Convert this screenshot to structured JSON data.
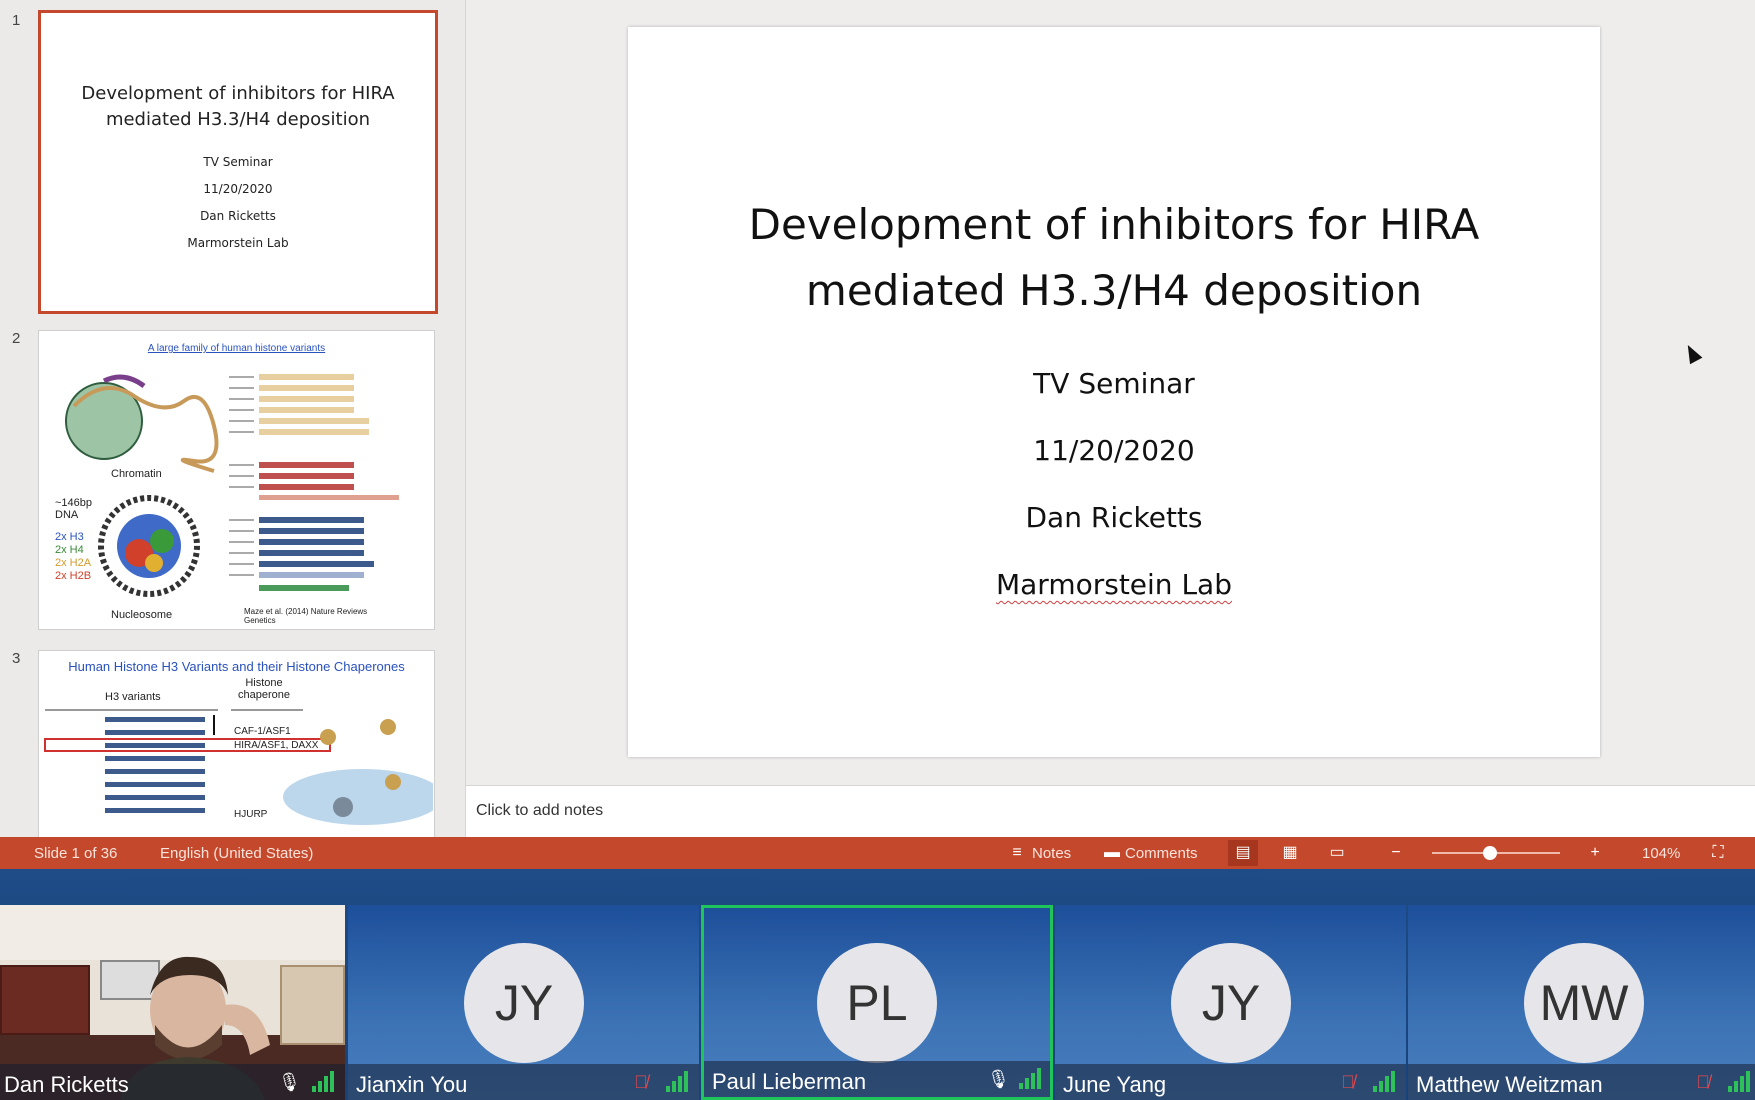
{
  "thumbnails": [
    {
      "number": "1",
      "title": "Development of inhibitors for HIRA mediated H3.3/H4 deposition",
      "lines": [
        "TV Seminar",
        "11/20/2020",
        "Dan Ricketts",
        "Marmorstein Lab"
      ]
    },
    {
      "number": "2",
      "title": "A large family of human histone variants",
      "labels": [
        "Chromatin",
        "~146bp DNA",
        "2x H3",
        "2x H4",
        "2x H2A",
        "2x H2B",
        "Nucleosome",
        "Maze et al. (2014) Nature Reviews Genetics"
      ]
    },
    {
      "number": "3",
      "title": "Human Histone H3 Variants and their Histone Chaperones",
      "labels": [
        "H3 variants",
        "Histone chaperone",
        "CAF-1/ASF1",
        "HIRA/ASF1, DAXX",
        "HJURP"
      ]
    }
  ],
  "slide": {
    "title_line1": "Development of inhibitors for HIRA",
    "title_line2": "mediated H3.3/H4 deposition",
    "subtitle": "TV Seminar",
    "date": "11/20/2020",
    "presenter": "Dan Ricketts",
    "lab": "Marmorstein Lab"
  },
  "notes_placeholder": "Click to add notes",
  "statusbar": {
    "slide_counter": "Slide 1 of 36",
    "language": "English (United States)",
    "notes_label": "Notes",
    "comments_label": "Comments",
    "zoom_level": "104%",
    "zoom_fraction": 0.45,
    "accent_color": "#c4492c"
  },
  "participants": [
    {
      "name": "Dan Ricketts",
      "initials": "",
      "video": true,
      "mic": "on",
      "active": false
    },
    {
      "name": "Jianxin You",
      "initials": "JY",
      "video": false,
      "mic": "muted",
      "active": false
    },
    {
      "name": "Paul Lieberman",
      "initials": "PL",
      "video": false,
      "mic": "on",
      "active": true
    },
    {
      "name": "June Yang",
      "initials": "JY",
      "video": false,
      "mic": "muted",
      "active": false
    },
    {
      "name": "Matthew Weitzman",
      "initials": "MW",
      "video": false,
      "mic": "muted",
      "active": false
    }
  ]
}
